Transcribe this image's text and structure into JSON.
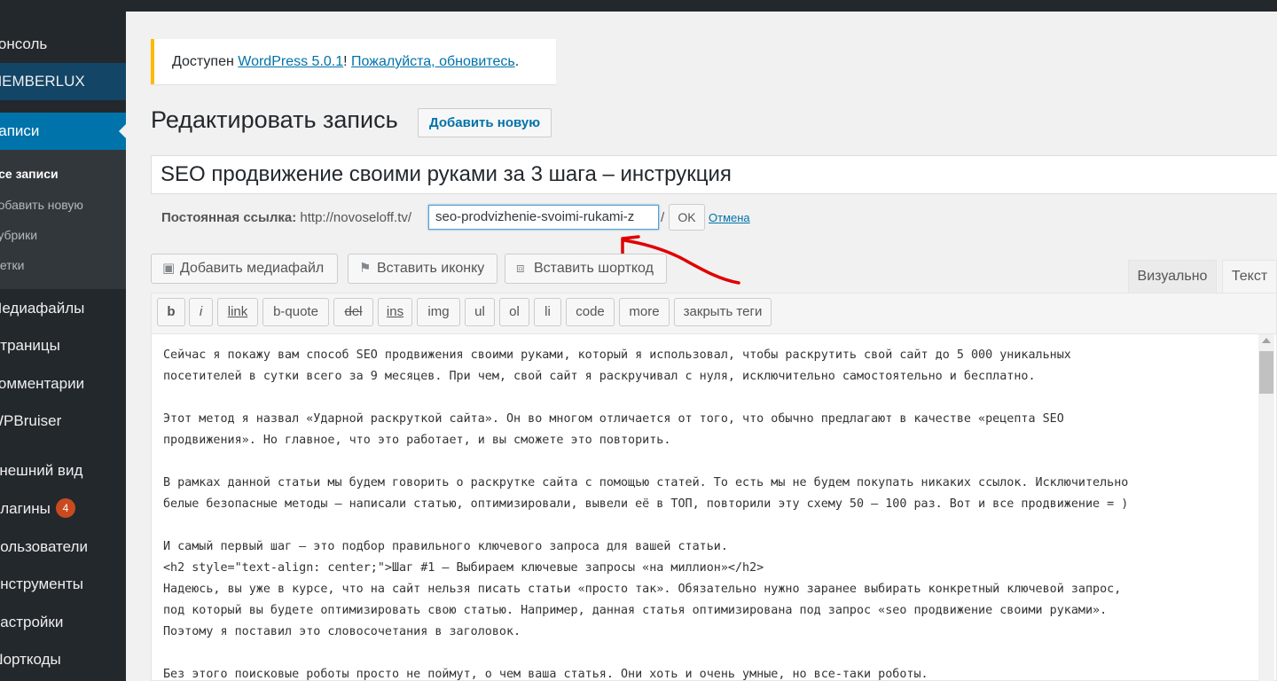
{
  "sidebar": {
    "items": [
      {
        "label": "Консоль",
        "icon": "dashboard-icon"
      },
      {
        "label": "MEMBERLUX",
        "icon": "memberlux-icon"
      },
      {
        "label": "Записи",
        "icon": "posts-icon"
      },
      {
        "label": "Медиафайлы",
        "icon": "media-icon"
      },
      {
        "label": "Страницы",
        "icon": "pages-icon"
      },
      {
        "label": "Комментарии",
        "icon": "comments-icon"
      },
      {
        "label": "WPBruiser",
        "icon": "shield-icon"
      },
      {
        "label": "Внешний вид",
        "icon": "appearance-icon"
      },
      {
        "label": "Плагины",
        "icon": "plugins-icon",
        "badge": "4"
      },
      {
        "label": "Пользователи",
        "icon": "users-icon"
      },
      {
        "label": "Инструменты",
        "icon": "tools-icon"
      },
      {
        "label": "Настройки",
        "icon": "settings-icon"
      },
      {
        "label": "Шорткоды",
        "icon": "shortcodes-icon"
      }
    ],
    "submenu": [
      "Все записи",
      "Добавить новую",
      "Рубрики",
      "Метки"
    ]
  },
  "notice": {
    "prefix": "Доступен ",
    "link1": "WordPress 5.0.1",
    "middle": "! ",
    "link2": "Пожалуйста, обновитесь",
    "suffix": "."
  },
  "page": {
    "title": "Редактировать запись",
    "add_new": "Добавить новую"
  },
  "post": {
    "title": "SEO продвижение своими руками за 3 шага – инструкция",
    "permalink_label": "Постоянная ссылка:",
    "permalink_base": "http://novoseloff.tv/",
    "slug": "seo-prodvizhenie-svoimi-rukami-z",
    "slug_sep": "/",
    "ok": "OK",
    "cancel": "Отмена"
  },
  "media_buttons": {
    "add_media": "Добавить медиафайл",
    "insert_icon": "Вставить иконку",
    "insert_shortcode": "Вставить шорткод"
  },
  "editor_tabs": {
    "visual": "Визуально",
    "text": "Текст",
    "active": "text"
  },
  "quicktags": [
    "b",
    "i",
    "link",
    "b-quote",
    "del",
    "ins",
    "img",
    "ul",
    "ol",
    "li",
    "code",
    "more",
    "закрыть теги"
  ],
  "editor": {
    "lines": [
      "Сейчас я покажу вам способ SEO продвижения своими руками, который я использовал, чтобы раскрутить свой сайт до 5 000 уникальных",
      "посетителей в сутки всего за 9 месяцев. При чем, свой сайт я раскручивал с нуля, исключительно самостоятельно и бесплатно.",
      "",
      "Этот метод я назвал «Ударной раскруткой сайта». Он во многом отличается от того, что обычно предлагают в качестве «рецепта SEO",
      "продвижения». Но главное, что это работает, и вы сможете это повторить.",
      "",
      "В рамках данной статьи мы будем говорить о раскрутке сайта с помощью статей. То есть мы не будем покупать никаких ссылок. Исключительно",
      "белые безопасные методы – написали статью, оптимизировали, вывели её в ТОП, повторили эту схему 50 – 100 раз. Вот и все продвижение = )",
      "",
      "И самый первый шаг – это подбор правильного ключевого запроса для вашей статьи.",
      "<h2 style=\"text-align: center;\">Шаг #1 – Выбираем ключевые запросы «на миллион»</h2>",
      "Надеюсь, вы уже в курсе, что на сайт нельзя писать статьи «просто так». Обязательно нужно заранее выбирать конкретный ключевой запрос,",
      "под который вы будете оптимизировать свою статью. Например, данная статья оптимизирована под запрос «seo продвижение своими руками».",
      "Поэтому я поставил это словосочетания в заголовок.",
      "",
      "Без этого поисковые роботы просто не поймут, о чем ваша статья. Они хоть и очень умные, но все-таки роботы."
    ]
  },
  "annotation": {
    "color": "#e00000"
  }
}
